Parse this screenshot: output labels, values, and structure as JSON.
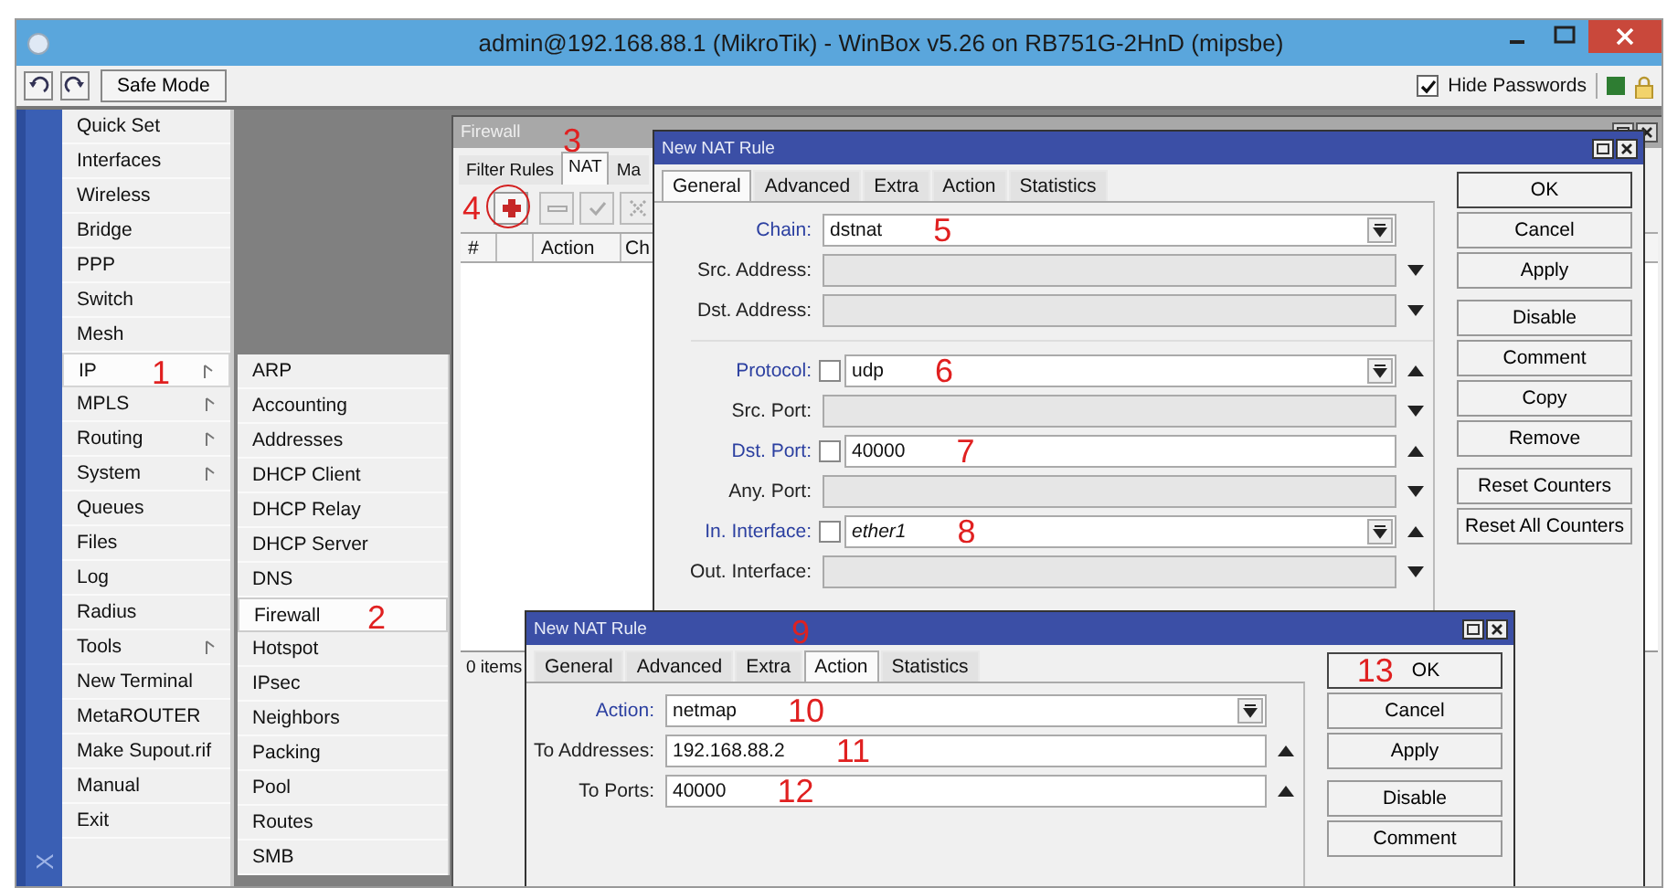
{
  "window": {
    "title": "admin@192.168.88.1 (MikroTik) - WinBox v5.26 on RB751G-2HnD (mipsbe)"
  },
  "toolbar": {
    "safe_mode": "Safe Mode",
    "hide_passwords": {
      "label": "Hide Passwords",
      "checked": true
    }
  },
  "sidebar": {
    "side_label": "X",
    "items": [
      {
        "label": "Quick Set",
        "submenu": false,
        "selected": false
      },
      {
        "label": "Interfaces",
        "submenu": false,
        "selected": false
      },
      {
        "label": "Wireless",
        "submenu": false,
        "selected": false
      },
      {
        "label": "Bridge",
        "submenu": false,
        "selected": false
      },
      {
        "label": "PPP",
        "submenu": false,
        "selected": false
      },
      {
        "label": "Switch",
        "submenu": false,
        "selected": false
      },
      {
        "label": "Mesh",
        "submenu": false,
        "selected": false
      },
      {
        "label": "IP",
        "submenu": true,
        "selected": true,
        "marker": "1"
      },
      {
        "label": "MPLS",
        "submenu": true,
        "selected": false
      },
      {
        "label": "Routing",
        "submenu": true,
        "selected": false
      },
      {
        "label": "System",
        "submenu": true,
        "selected": false
      },
      {
        "label": "Queues",
        "submenu": false,
        "selected": false
      },
      {
        "label": "Files",
        "submenu": false,
        "selected": false
      },
      {
        "label": "Log",
        "submenu": false,
        "selected": false
      },
      {
        "label": "Radius",
        "submenu": false,
        "selected": false
      },
      {
        "label": "Tools",
        "submenu": true,
        "selected": false
      },
      {
        "label": "New Terminal",
        "submenu": false,
        "selected": false
      },
      {
        "label": "MetaROUTER",
        "submenu": false,
        "selected": false
      },
      {
        "label": "Make Supout.rif",
        "submenu": false,
        "selected": false
      },
      {
        "label": "Manual",
        "submenu": false,
        "selected": false
      },
      {
        "label": "Exit",
        "submenu": false,
        "selected": false
      }
    ]
  },
  "submenu": {
    "items": [
      {
        "label": "ARP",
        "selected": false
      },
      {
        "label": "Accounting",
        "selected": false
      },
      {
        "label": "Addresses",
        "selected": false
      },
      {
        "label": "DHCP Client",
        "selected": false
      },
      {
        "label": "DHCP Relay",
        "selected": false
      },
      {
        "label": "DHCP Server",
        "selected": false
      },
      {
        "label": "DNS",
        "selected": false
      },
      {
        "label": "Firewall",
        "selected": true,
        "marker": "2"
      },
      {
        "label": "Hotspot",
        "selected": false
      },
      {
        "label": "IPsec",
        "selected": false
      },
      {
        "label": "Neighbors",
        "selected": false
      },
      {
        "label": "Packing",
        "selected": false
      },
      {
        "label": "Pool",
        "selected": false
      },
      {
        "label": "Routes",
        "selected": false
      },
      {
        "label": "SMB",
        "selected": false
      }
    ]
  },
  "firewall": {
    "title": "Firewall",
    "tabs": [
      {
        "label": "Filter Rules",
        "selected": false
      },
      {
        "label": "NAT",
        "selected": true,
        "marker": "3"
      },
      {
        "label": "Ma",
        "selected": false
      }
    ],
    "tools": [
      {
        "kind": "add",
        "disabled": false,
        "marker": "4"
      },
      {
        "kind": "remove",
        "disabled": true
      },
      {
        "kind": "enable",
        "disabled": true
      },
      {
        "kind": "disable",
        "disabled": true
      }
    ],
    "columns": [
      "#",
      "Action",
      "Ch"
    ],
    "status": "0 items"
  },
  "dialogs": [
    {
      "title": "New NAT Rule",
      "tabs": [
        {
          "label": "General",
          "selected": true
        },
        {
          "label": "Advanced",
          "selected": false
        },
        {
          "label": "Extra",
          "selected": false
        },
        {
          "label": "Action",
          "selected": false
        },
        {
          "label": "Statistics",
          "selected": false
        }
      ],
      "groups": [
        [
          {
            "label": "Chain:",
            "value": "dstnat",
            "marker": "5",
            "highlighted": true,
            "dropdown": true
          },
          {
            "label": "Src. Address:",
            "highlighted": false,
            "expanded": false
          },
          {
            "label": "Dst. Address:",
            "highlighted": false,
            "expanded": false
          }
        ],
        [
          {
            "label": "Protocol:",
            "value": "udp",
            "marker": "6",
            "highlighted": true,
            "checked": false,
            "dropdown": true,
            "expanded": true
          },
          {
            "label": "Src. Port:",
            "highlighted": false,
            "expanded": false
          },
          {
            "label": "Dst. Port:",
            "value": "40000",
            "marker": "7",
            "highlighted": true,
            "checked": false,
            "expanded": true
          },
          {
            "label": "Any. Port:",
            "highlighted": false,
            "expanded": false
          },
          {
            "label": "In. Interface:",
            "value": "ether1",
            "italic": true,
            "marker": "8",
            "highlighted": true,
            "checked": false,
            "dropdown": true,
            "expanded": true
          },
          {
            "label": "Out. Interface:",
            "highlighted": false,
            "expanded": false
          }
        ]
      ],
      "button_groups": [
        [
          {
            "label": "OK",
            "default": true
          },
          {
            "label": "Cancel"
          },
          {
            "label": "Apply"
          }
        ],
        [
          {
            "label": "Disable"
          },
          {
            "label": "Comment"
          },
          {
            "label": "Copy"
          },
          {
            "label": "Remove"
          }
        ],
        [
          {
            "label": "Reset Counters"
          },
          {
            "label": "Reset All Counters"
          }
        ]
      ]
    },
    {
      "title": "New NAT Rule",
      "marker": "9",
      "tabs": [
        {
          "label": "General",
          "selected": false
        },
        {
          "label": "Advanced",
          "selected": false
        },
        {
          "label": "Extra",
          "selected": false
        },
        {
          "label": "Action",
          "selected": true
        },
        {
          "label": "Statistics",
          "selected": false
        }
      ],
      "groups": [
        [
          {
            "label": "Action:",
            "value": "netmap",
            "marker": "10",
            "highlighted": true,
            "dropdown": true
          },
          {
            "label": "To Addresses:",
            "value": "192.168.88.2",
            "marker": "11",
            "highlighted": false,
            "expanded": true
          },
          {
            "label": "To Ports:",
            "value": "40000",
            "marker": "12",
            "highlighted": false,
            "expanded": true
          }
        ]
      ],
      "button_groups": [
        [
          {
            "label": "OK",
            "default": true,
            "marker": "13"
          },
          {
            "label": "Cancel"
          },
          {
            "label": "Apply"
          }
        ],
        [
          {
            "label": "Disable"
          },
          {
            "label": "Comment"
          }
        ]
      ]
    }
  ]
}
